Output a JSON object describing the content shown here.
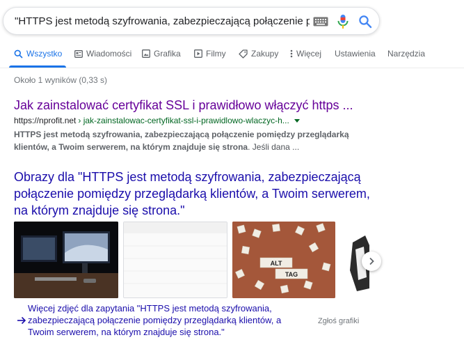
{
  "search": {
    "query": "\"HTTPS jest metodą szyfrowania, zabezpieczającą połączenie pomię",
    "icons": [
      "keyboard-icon",
      "mic-icon",
      "search-icon"
    ]
  },
  "tabs": [
    {
      "label": "Wszystko",
      "icon": "search-icon",
      "active": true
    },
    {
      "label": "Wiadomości",
      "icon": "news-icon"
    },
    {
      "label": "Grafika",
      "icon": "image-icon"
    },
    {
      "label": "Filmy",
      "icon": "video-icon"
    },
    {
      "label": "Zakupy",
      "icon": "tag-icon"
    },
    {
      "label": "Więcej",
      "icon": "more-vert-icon"
    },
    {
      "label": "Ustawienia"
    },
    {
      "label": "Narzędzia"
    }
  ],
  "stats": "Około 1 wyników (0,33 s)",
  "result": {
    "title": "Jak zainstalować certyfikat SSL i prawidłowo włączyć https ...",
    "url_domain": "https://nprofit.net",
    "url_path": " › jak-zainstalowac-certyfikat-ssl-i-prawidlowo-wlaczyc-h...",
    "snippet_bold_1": "HTTPS jest metodą szyfrowania, zabezpieczającą połączenie pomiędzy przeglądarką",
    "snippet_bold_2": "klientów, a Twoim serwerem, na którym znajduje się strona",
    "snippet_tail": ". Jeśli dana ..."
  },
  "images": {
    "heading": "Obrazy dla \"HTTPS jest metodą szyfrowania, zabezpieczającą połączenie pomiędzy przeglądarką klientów, a Twoim serwerem, na którym znajduje się strona.\"",
    "scrabble_tiles": [
      "ALT",
      "TAG"
    ],
    "more_text": "Więcej zdjęć dla zapytania \"HTTPS jest metodą szyfrowania, zabezpieczającą połączenie pomiędzy przeglądarką klientów, a Twoim serwerem, na którym znajduje się strona.\"",
    "report": "Zgłoś grafiki"
  },
  "colors": {
    "accent": "#1a73e8",
    "visited_link": "#660099",
    "link": "#1a0dab",
    "url_green": "#006621"
  }
}
